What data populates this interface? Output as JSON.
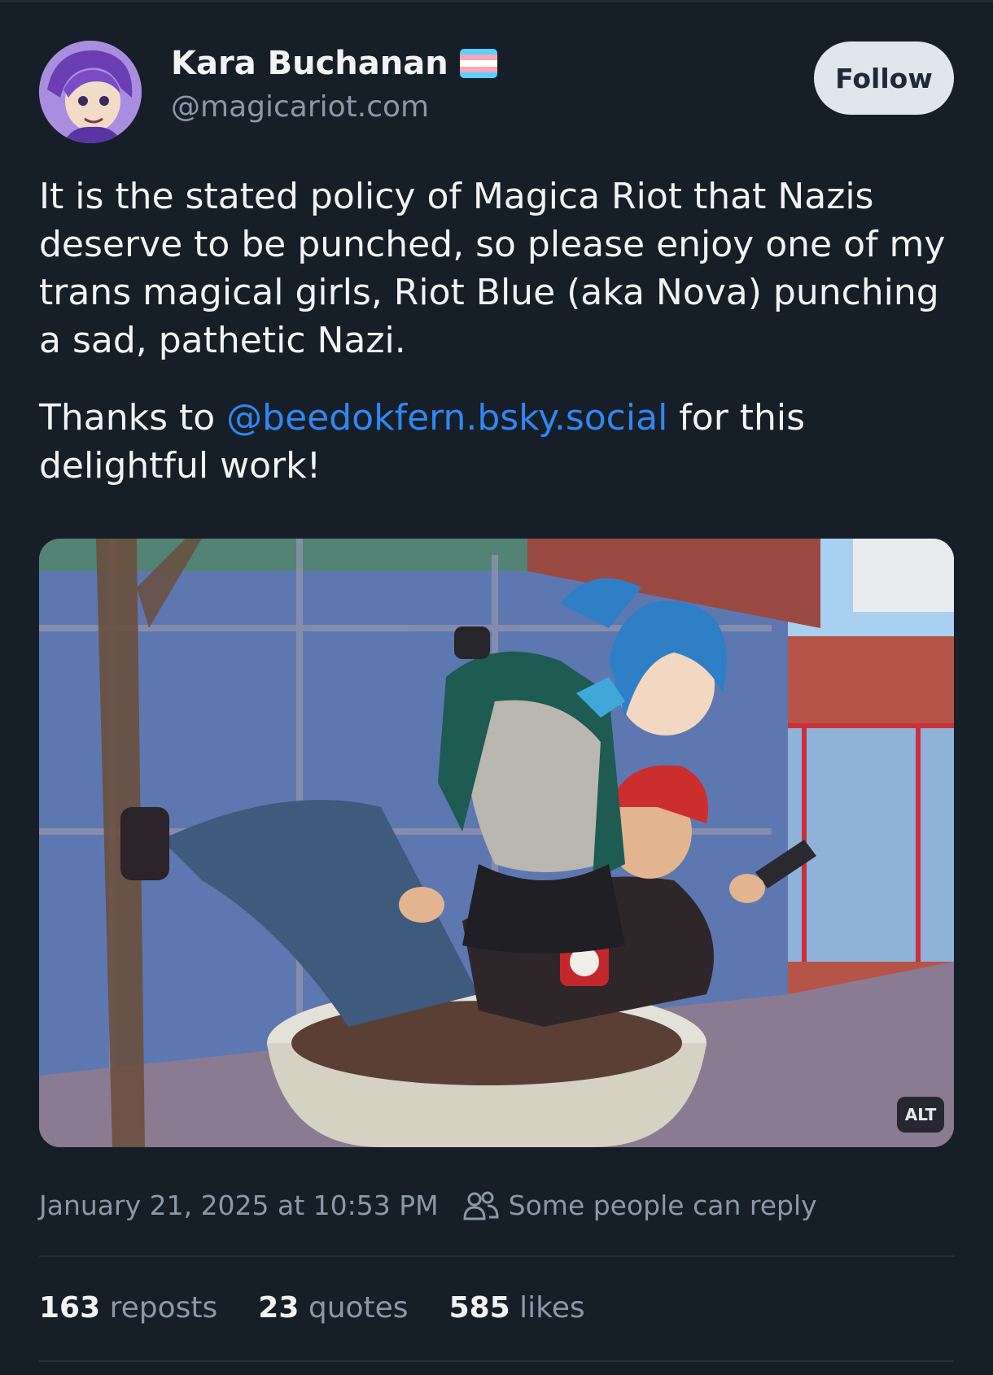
{
  "author": {
    "display_name": "Kara Buchanan",
    "handle": "@magicariot.com"
  },
  "follow_label": "Follow",
  "post": {
    "paragraph1": "It is the stated policy of Magica Riot that Nazis deserve to be punched, so please enjoy one of my trans magical girls, Riot Blue (aka Nova) punching a sad, pathetic Nazi.",
    "paragraph2_before": "Thanks to ",
    "mention": "@beedokfern.bsky.social",
    "paragraph2_after": " for this delightful work!"
  },
  "image": {
    "alt_label": "ALT"
  },
  "meta": {
    "timestamp": "January 21, 2025 at 10:53 PM",
    "reply_setting": "Some people can reply"
  },
  "stats": {
    "reposts_count": "163",
    "reposts_label": "reposts",
    "quotes_count": "23",
    "quotes_label": "quotes",
    "likes_count": "585",
    "likes_label": "likes"
  },
  "colors": {
    "background": "#161e27",
    "link": "#2f87f3",
    "muted": "#8b98a8",
    "follow_bg": "#dfe6ee"
  }
}
